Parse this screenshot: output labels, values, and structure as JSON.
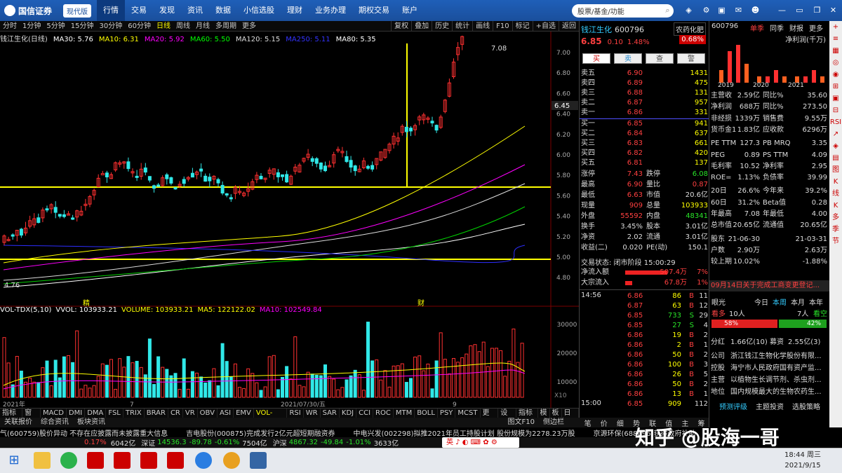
{
  "app": {
    "brand": "国信证券",
    "version": "现代版",
    "nav": [
      "行情",
      "交易",
      "发现",
      "资讯",
      "数据",
      "小信选股",
      "理财",
      "业务办理",
      "期权交易",
      "账户"
    ],
    "search_placeholder": "股票/基金/功能"
  },
  "chart_toolbar": {
    "periods": [
      "分时",
      "1分钟",
      "5分钟",
      "15分钟",
      "30分钟",
      "60分钟",
      "日线",
      "周线",
      "月线",
      "多周期",
      "更多"
    ],
    "active": "日线",
    "tools": [
      "复权",
      "叠加",
      "历史",
      "统计",
      "画线",
      "F10",
      "标记",
      "+自选",
      "返回"
    ]
  },
  "ma_legend": {
    "title": "钱江生化(日线)",
    "items": [
      {
        "label": "MA30: 5.76",
        "color": "#ffffff"
      },
      {
        "label": "MA10: 6.31",
        "color": "#ffff00"
      },
      {
        "label": "MA20: 5.92",
        "color": "#ff00ff"
      },
      {
        "label": "MA60: 5.50",
        "color": "#00ff00"
      },
      {
        "label": "MA120: 5.15",
        "color": "#dddddd"
      },
      {
        "label": "MA250: 5.11",
        "color": "#3333ff"
      },
      {
        "label": "MA80: 5.35",
        "color": "#ffffff"
      }
    ]
  },
  "vol_legend": {
    "items": [
      {
        "label": "VOL-TDX(5,10)",
        "color": "#ffffff"
      },
      {
        "label": "VVOL: 103933.21",
        "color": "#ffffff"
      },
      {
        "label": "VOLUME: 103933.21",
        "color": "#ffff00"
      },
      {
        "label": "MA5: 122122.02",
        "color": "#ffff00"
      },
      {
        "label": "MA10: 102549.84",
        "color": "#ff00ff"
      }
    ]
  },
  "price_axis": [
    "7.00",
    "6.80",
    "6.60",
    "6.40",
    "6.20",
    "6.00",
    "5.80",
    "5.60",
    "5.40",
    "5.20",
    "5.00",
    "4.80"
  ],
  "vol_axis": [
    "30000",
    "20000",
    "10000"
  ],
  "chart_labels": {
    "high_mark": "7.08",
    "low_mark": "4.76",
    "current": "6.45",
    "marker1": "精",
    "marker2": "财",
    "x_start": "2021年",
    "x_mid": "7",
    "x_date": "2021/07/30/五",
    "x_end": "9",
    "x10": "X10"
  },
  "indicator_tabs": [
    "指标A",
    "窗口",
    "MACD",
    "DMI",
    "DMA",
    "FSL",
    "TRIX",
    "BRAR",
    "CR",
    "VR",
    "OBV",
    "ASI",
    "EMV",
    "VOL-TDX",
    "RSI",
    "WR",
    "SAR",
    "KDJ",
    "CCI",
    "ROC",
    "MTM",
    "BOLL",
    "PSY",
    "MCST",
    "更多",
    "设置"
  ],
  "indicator_right": [
    "指标B",
    "模",
    "板",
    "日线"
  ],
  "sub_tabs": [
    "关联报价",
    "综合资讯",
    "板块资讯"
  ],
  "sub_right": [
    "图文F10",
    "侧边栏"
  ],
  "quote": {
    "name": "钱江生化",
    "code": "600796",
    "price": "6.85",
    "change": "0.10",
    "pct": "1.48%",
    "sector": "农药化肥",
    "sector_pct": "0.68%",
    "buttons": [
      "买",
      "卖",
      "查",
      "警"
    ],
    "asks": [
      [
        "卖五",
        "6.90",
        "1431"
      ],
      [
        "卖四",
        "6.89",
        "475"
      ],
      [
        "卖三",
        "6.88",
        "131"
      ],
      [
        "卖二",
        "6.87",
        "957"
      ],
      [
        "卖一",
        "6.86",
        "331"
      ]
    ],
    "bids": [
      [
        "买一",
        "6.85",
        "941"
      ],
      [
        "买二",
        "6.84",
        "637"
      ],
      [
        "买三",
        "6.83",
        "661"
      ],
      [
        "买四",
        "6.82",
        "420"
      ],
      [
        "买五",
        "6.81",
        "137"
      ]
    ],
    "stats": [
      [
        "涨停",
        "7.43",
        "跌停",
        "6.08"
      ],
      [
        "最高",
        "6.90",
        "量比",
        "0.87"
      ],
      [
        "最低",
        "6.63",
        "市值",
        "20.6亿"
      ],
      [
        "现量",
        "909",
        "总量",
        "103933"
      ],
      [
        "外盘",
        "55592",
        "内盘",
        "48341"
      ],
      [
        "换手",
        "3.45%",
        "股本",
        "3.01亿"
      ],
      [
        "净资",
        "2.02",
        "流通",
        "3.01亿"
      ],
      [
        "收益(二)",
        "0.020",
        "PE(动)",
        "150.1"
      ]
    ],
    "trade_status": "交易状态: 闭市阶段  15:00:29",
    "flows": [
      [
        "净流入额",
        "507.4万",
        "7%"
      ],
      [
        "大宗流入",
        "67.8万",
        "1%"
      ]
    ],
    "ticks_time_start": "14:56",
    "ticks_time_end": "15:00",
    "ticks": [
      [
        "6.86",
        "86",
        "B",
        "11"
      ],
      [
        "6.87",
        "63",
        "B",
        "12"
      ],
      [
        "6.85",
        "733",
        "S",
        "29"
      ],
      [
        "6.85",
        "27",
        "S",
        "4"
      ],
      [
        "6.86",
        "19",
        "B",
        "2"
      ],
      [
        "6.86",
        "2",
        "B",
        "1"
      ],
      [
        "6.86",
        "50",
        "B",
        "2"
      ],
      [
        "6.86",
        "100",
        "B",
        "3"
      ],
      [
        "6.86",
        "26",
        "B",
        "5"
      ],
      [
        "6.86",
        "50",
        "B",
        "2"
      ],
      [
        "6.86",
        "13",
        "B",
        "1"
      ],
      [
        "6.85",
        "909",
        "",
        "112"
      ]
    ],
    "bottom_tabs": [
      "笔",
      "价",
      "细",
      "势",
      "联",
      "值",
      "主",
      "筹"
    ]
  },
  "fin": {
    "code": "600796",
    "tabs": [
      "单季",
      "同季",
      "财报",
      "更多"
    ],
    "chart_title": "净利润(千万)",
    "years": [
      "2019",
      "2020",
      "2021"
    ],
    "bars": [
      2,
      5,
      6,
      3,
      1,
      1,
      2,
      1,
      1,
      1,
      2,
      1
    ],
    "rows": [
      [
        "主营收",
        "2.59亿",
        "同比%",
        "35.60"
      ],
      [
        "净利润",
        "688万",
        "同比%",
        "273.50"
      ],
      [
        "非经损",
        "1339万",
        "销售费",
        "9.55万"
      ],
      [
        "货币金1",
        "1.83亿",
        "应收款",
        "6296万"
      ],
      [
        "PE TTM",
        "127.3",
        "PB MRQ",
        "3.35"
      ],
      [
        "PEG",
        "0.89",
        "PS TTM",
        "4.09"
      ],
      [
        "毛利率",
        "10.52",
        "净利率",
        "2.95"
      ],
      [
        "ROE=",
        "1.13%",
        "负债率",
        "39.99"
      ],
      [
        "20日",
        "26.6%",
        "今年来",
        "39.2%"
      ],
      [
        "60日",
        "31.2%",
        "Beta值",
        "0.28"
      ],
      [
        "年最高",
        "7.08",
        "年最低",
        "4.00"
      ],
      [
        "总市值",
        "20.65亿",
        "流通值",
        "20.65亿"
      ],
      [
        "股东",
        "21-06-30",
        "",
        "21-03-31"
      ],
      [
        "户数",
        "2.90万",
        "",
        "2.63万"
      ],
      [
        "较上期",
        "10.02%",
        "",
        "-1.88%"
      ]
    ],
    "news_title": "09月14日关于完成工商变更登记...",
    "sentiment": {
      "title": "眼光",
      "tabs": [
        "今日",
        "本周",
        "本月",
        "本年"
      ],
      "bull_label": "看多",
      "bull_count": "10人",
      "bear_count": "7人",
      "bear_label": "看空",
      "bull_pct": "58%",
      "bear_pct": "42%"
    },
    "split": [
      "分红",
      "1.66亿(10)",
      "募资",
      "2.55亿(3)"
    ],
    "company": [
      [
        "公司",
        "浙江钱江生物化学股份有限..."
      ],
      [
        "控股",
        "海宁市人民政府国有资产监..."
      ],
      [
        "主营",
        "以植物生长调节剂、杀虫剂..."
      ],
      [
        "地位",
        "国内规模最大的生物农药生..."
      ]
    ],
    "footer": [
      "预测评级",
      "主题投资",
      "选股策略"
    ]
  },
  "right_toolbar": [
    "+",
    "≡",
    "▦",
    "◎",
    "◉",
    "⊞",
    "▣",
    "⊟",
    "RSI",
    "↗",
    "◈",
    "▤",
    "图",
    "K",
    "线",
    "K",
    "多",
    "季",
    "节"
  ],
  "news": [
    "气(600759)股价异动 不存在应披露而未披露重大信息",
    "吉电股份(000875)完成发行2亿元超短期融资券",
    "中电兴发(002298)拟推2021年员工持股计划 股份规模为2278.23万股",
    "京源环保(688096)获得政府补助"
  ],
  "status_bar": {
    "a": "0.17%",
    "b": "6042亿",
    "sz_label": "深证",
    "sz": "14536.3",
    "sz_chg": "-89.78",
    "sz_pct": "-0.61%",
    "sz_amt": "7504亿",
    "hs_label": "沪深",
    "hs": "4867.32",
    "hs_chg": "-49.84",
    "hs_pct": "-1.01%",
    "hs_amt": "3633亿",
    "ime": "英 ♪ ◐ ⌨ ✿ ⚙"
  },
  "taskbar": {
    "time": "18:44 周三",
    "date": "2021/9/15"
  },
  "watermark": "知乎 @股海一哥"
}
